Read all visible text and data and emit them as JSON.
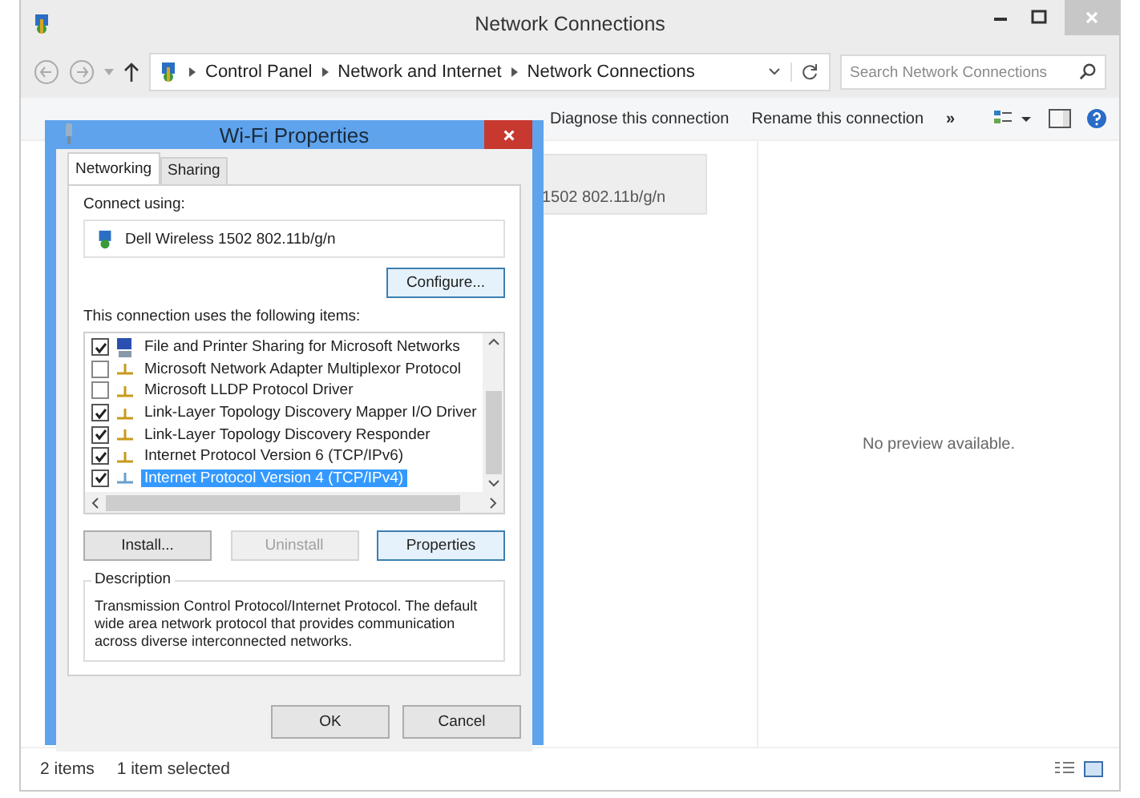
{
  "window": {
    "title": "Network Connections"
  },
  "address_bar": {
    "path": [
      "Control Panel",
      "Network and Internet",
      "Network Connections"
    ]
  },
  "search": {
    "placeholder": "Search Network Connections"
  },
  "toolbar": [
    {
      "kind": "command",
      "label": "Diagnose this connection"
    },
    {
      "kind": "command",
      "label": "Rename this connection"
    },
    {
      "kind": "more",
      "label": "»"
    }
  ],
  "connection_tile": {
    "text": "1502 802.11b/g/n",
    "selected": true
  },
  "preview": {
    "text": "No preview available."
  },
  "status_bar": [
    "2 items",
    "1 item selected"
  ],
  "dialog": {
    "title": "Wi-Fi Properties",
    "tabs": [
      {
        "label": "Networking",
        "selected": true
      },
      {
        "label": "Sharing",
        "selected": false
      }
    ],
    "connect_label": "Connect using:",
    "adapter": "Dell Wireless 1502 802.11b/g/n",
    "configure_button": "Configure...",
    "items_label": "This connection uses the following items:",
    "items": [
      {
        "kind": "service",
        "label": "File and Printer Sharing for Microsoft Networks",
        "checked": true,
        "selected": false
      },
      {
        "kind": "protocol",
        "label": "Microsoft Network Adapter Multiplexor Protocol",
        "checked": false,
        "selected": false
      },
      {
        "kind": "protocol",
        "label": "Microsoft LLDP Protocol Driver",
        "checked": false,
        "selected": false
      },
      {
        "kind": "protocol",
        "label": "Link-Layer Topology Discovery Mapper I/O Driver",
        "checked": true,
        "selected": false
      },
      {
        "kind": "protocol",
        "label": "Link-Layer Topology Discovery Responder",
        "checked": true,
        "selected": false
      },
      {
        "kind": "protocol",
        "label": "Internet Protocol Version 6 (TCP/IPv6)",
        "checked": true,
        "selected": false
      },
      {
        "kind": "protocol",
        "label": "Internet Protocol Version 4 (TCP/IPv4)",
        "checked": true,
        "selected": true
      }
    ],
    "item_buttons": [
      {
        "label": "Install...",
        "disabled": false
      },
      {
        "label": "Uninstall",
        "disabled": true
      },
      {
        "label": "Properties",
        "disabled": false
      }
    ],
    "description": {
      "title": "Description",
      "text": "Transmission Control Protocol/Internet Protocol. The default wide area network protocol that provides communication across diverse interconnected networks."
    },
    "buttons": [
      "OK",
      "Cancel"
    ]
  }
}
